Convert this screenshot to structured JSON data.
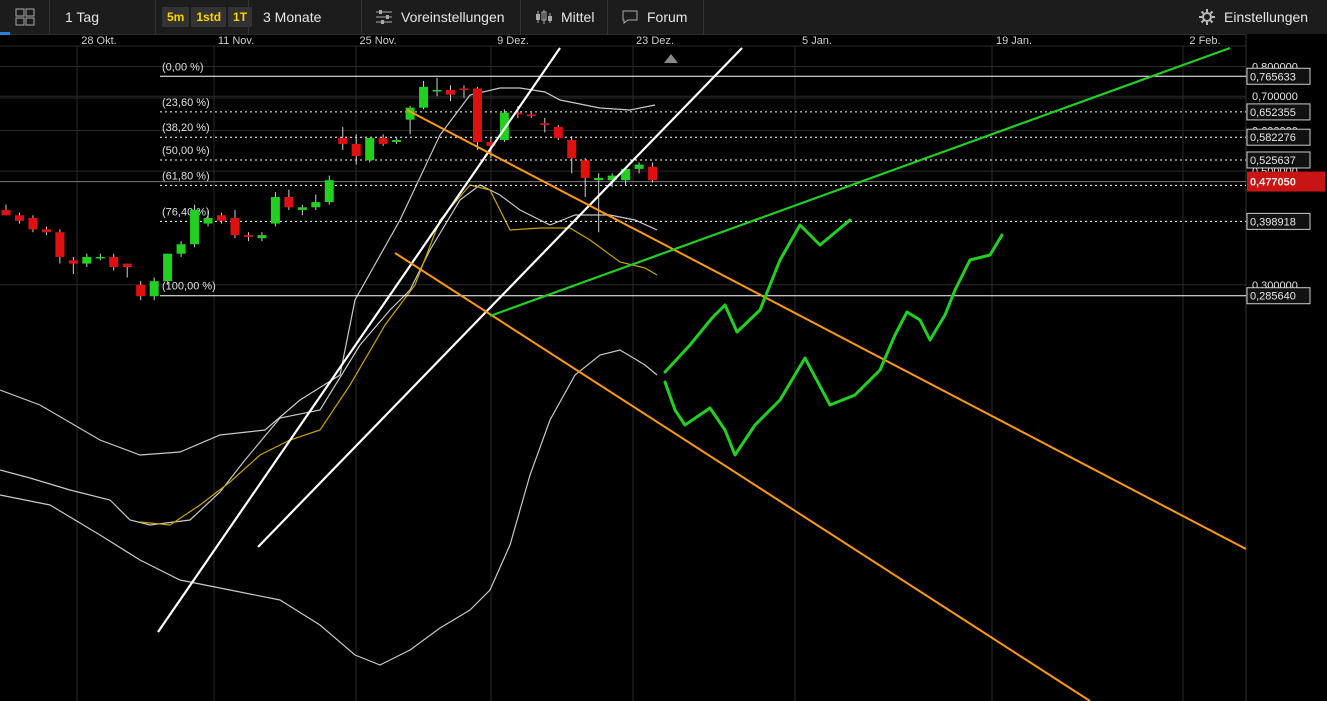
{
  "toolbar": {
    "interval": "1 Tag",
    "quick_5m": "5m",
    "quick_1std": "1std",
    "quick_1t": "1T",
    "range": "3 Monate",
    "presets": "Voreinstellungen",
    "indicator": "Mittel",
    "forum": "Forum",
    "settings": "Einstellungen"
  },
  "colors": {
    "bull": "#22d022",
    "bear": "#e01010",
    "fib": "#ffffff",
    "channel": "#ff9a10",
    "trend_green": "#22d022",
    "bollinger": "#c8c8c8",
    "sma": "#c8a400",
    "price_badge": "#c81414"
  },
  "chart_data": {
    "type": "candlestick",
    "x_ticks": [
      "28 Okt.",
      "11 Nov.",
      "25 Nov.",
      "9 Dez.",
      "23 Dez.",
      "5 Jan.",
      "19 Jan.",
      "2 Feb."
    ],
    "y_ticks": [
      "0,800000",
      "0,700000",
      "0,600000",
      "0,500000",
      "0,300000"
    ],
    "ylim": [
      0.2,
      0.85
    ],
    "current_price": "0,477050",
    "fib_levels": [
      {
        "pct": "(0,00 %)",
        "value": 0.765633,
        "label": "0,765633"
      },
      {
        "pct": "(23,60 %)",
        "value": 0.652355,
        "label": "0,652355"
      },
      {
        "pct": "(38,20 %)",
        "value": 0.582276,
        "label": "0,582276"
      },
      {
        "pct": "(50,00 %)",
        "value": 0.525637,
        "label": "0,525637"
      },
      {
        "pct": "(61,80 %)",
        "value": 0.469,
        "label": ""
      },
      {
        "pct": "(76,40 %)",
        "value": 0.398918,
        "label": "0,398918"
      },
      {
        "pct": "(100,00 %)",
        "value": 0.28564,
        "label": "0,285640"
      }
    ],
    "candles": [
      {
        "o": 0.42,
        "h": 0.43,
        "l": 0.41,
        "c": 0.41
      },
      {
        "o": 0.41,
        "h": 0.415,
        "l": 0.395,
        "c": 0.4
      },
      {
        "o": 0.405,
        "h": 0.41,
        "l": 0.38,
        "c": 0.385
      },
      {
        "o": 0.385,
        "h": 0.39,
        "l": 0.375,
        "c": 0.38
      },
      {
        "o": 0.38,
        "h": 0.385,
        "l": 0.33,
        "c": 0.34
      },
      {
        "o": 0.335,
        "h": 0.34,
        "l": 0.315,
        "c": 0.33
      },
      {
        "o": 0.33,
        "h": 0.345,
        "l": 0.325,
        "c": 0.34
      },
      {
        "o": 0.34,
        "h": 0.345,
        "l": 0.335,
        "c": 0.34
      },
      {
        "o": 0.34,
        "h": 0.345,
        "l": 0.32,
        "c": 0.325
      },
      {
        "o": 0.33,
        "h": 0.33,
        "l": 0.31,
        "c": 0.325
      },
      {
        "o": 0.3,
        "h": 0.305,
        "l": 0.28,
        "c": 0.285
      },
      {
        "o": 0.285,
        "h": 0.31,
        "l": 0.28,
        "c": 0.305
      },
      {
        "o": 0.305,
        "h": 0.345,
        "l": 0.3,
        "c": 0.345
      },
      {
        "o": 0.345,
        "h": 0.365,
        "l": 0.34,
        "c": 0.36
      },
      {
        "o": 0.36,
        "h": 0.43,
        "l": 0.355,
        "c": 0.42
      },
      {
        "o": 0.395,
        "h": 0.42,
        "l": 0.39,
        "c": 0.405
      },
      {
        "o": 0.41,
        "h": 0.415,
        "l": 0.395,
        "c": 0.4
      },
      {
        "o": 0.405,
        "h": 0.42,
        "l": 0.37,
        "c": 0.375
      },
      {
        "o": 0.375,
        "h": 0.38,
        "l": 0.365,
        "c": 0.372
      },
      {
        "o": 0.37,
        "h": 0.38,
        "l": 0.365,
        "c": 0.375
      },
      {
        "o": 0.395,
        "h": 0.455,
        "l": 0.39,
        "c": 0.445
      },
      {
        "o": 0.445,
        "h": 0.46,
        "l": 0.42,
        "c": 0.425
      },
      {
        "o": 0.42,
        "h": 0.43,
        "l": 0.41,
        "c": 0.425
      },
      {
        "o": 0.425,
        "h": 0.45,
        "l": 0.42,
        "c": 0.435
      },
      {
        "o": 0.435,
        "h": 0.49,
        "l": 0.43,
        "c": 0.48
      },
      {
        "o": 0.58,
        "h": 0.61,
        "l": 0.55,
        "c": 0.565
      },
      {
        "o": 0.565,
        "h": 0.59,
        "l": 0.515,
        "c": 0.535
      },
      {
        "o": 0.525,
        "h": 0.58,
        "l": 0.52,
        "c": 0.58
      },
      {
        "o": 0.58,
        "h": 0.59,
        "l": 0.56,
        "c": 0.565
      },
      {
        "o": 0.57,
        "h": 0.58,
        "l": 0.565,
        "c": 0.575
      },
      {
        "o": 0.63,
        "h": 0.67,
        "l": 0.59,
        "c": 0.665
      },
      {
        "o": 0.665,
        "h": 0.75,
        "l": 0.66,
        "c": 0.73
      },
      {
        "o": 0.715,
        "h": 0.76,
        "l": 0.7,
        "c": 0.72
      },
      {
        "o": 0.72,
        "h": 0.735,
        "l": 0.685,
        "c": 0.705
      },
      {
        "o": 0.725,
        "h": 0.735,
        "l": 0.695,
        "c": 0.72
      },
      {
        "o": 0.725,
        "h": 0.73,
        "l": 0.55,
        "c": 0.57
      },
      {
        "o": 0.57,
        "h": 0.58,
        "l": 0.53,
        "c": 0.56
      },
      {
        "o": 0.575,
        "h": 0.66,
        "l": 0.57,
        "c": 0.65
      },
      {
        "o": 0.65,
        "h": 0.67,
        "l": 0.635,
        "c": 0.645
      },
      {
        "o": 0.645,
        "h": 0.65,
        "l": 0.635,
        "c": 0.64
      },
      {
        "o": 0.62,
        "h": 0.635,
        "l": 0.595,
        "c": 0.615
      },
      {
        "o": 0.61,
        "h": 0.615,
        "l": 0.575,
        "c": 0.58
      },
      {
        "o": 0.575,
        "h": 0.585,
        "l": 0.495,
        "c": 0.53
      },
      {
        "o": 0.525,
        "h": 0.53,
        "l": 0.445,
        "c": 0.485
      },
      {
        "o": 0.48,
        "h": 0.495,
        "l": 0.38,
        "c": 0.485
      },
      {
        "o": 0.48,
        "h": 0.495,
        "l": 0.465,
        "c": 0.49
      },
      {
        "o": 0.48,
        "h": 0.505,
        "l": 0.468,
        "c": 0.505
      },
      {
        "o": 0.505,
        "h": 0.52,
        "l": 0.495,
        "c": 0.515
      },
      {
        "o": 0.51,
        "h": 0.52,
        "l": 0.475,
        "c": 0.48
      }
    ]
  }
}
